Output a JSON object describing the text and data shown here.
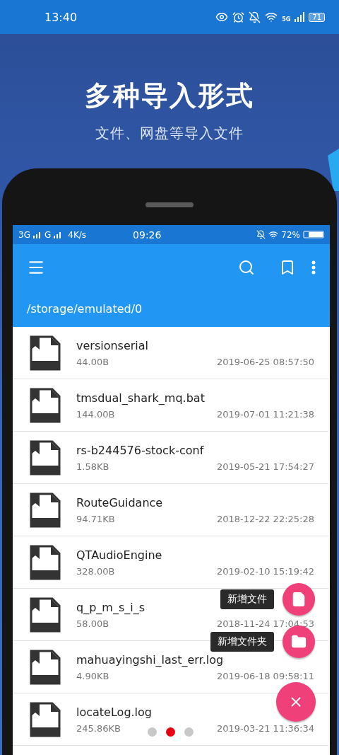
{
  "status_bar": {
    "time": "13:40",
    "network": "5G",
    "battery": "71"
  },
  "headline": "多种导入形式",
  "subheadline": "文件、网盘等导入文件",
  "phone": {
    "status_bar": {
      "network_1": "3G",
      "network_2": "G",
      "speed": "4K/s",
      "time": "09:26",
      "battery": "72%"
    },
    "path": "/storage/emulated/0",
    "files": [
      {
        "name": "versionserial",
        "size": "44.00B",
        "date": "2019-06-25 08:57:50"
      },
      {
        "name": "tmsdual_shark_mq.bat",
        "size": "144.00B",
        "date": "2019-07-01 11:21:38"
      },
      {
        "name": "rs-b244576-stock-conf",
        "size": "1.58KB",
        "date": "2019-05-21 17:54:27"
      },
      {
        "name": "RouteGuidance",
        "size": "94.71KB",
        "date": "2018-12-22 22:25:28"
      },
      {
        "name": "QTAudioEngine",
        "size": "328.00B",
        "date": "2019-02-10 15:19:42"
      },
      {
        "name": "q_p_m_s_i_s",
        "size": "58.00B",
        "date": "2018-11-24 17:04:53"
      },
      {
        "name": "mahuayingshi_last_err.log",
        "size": "4.90KB",
        "date": "2019-06-18 09:58:11"
      },
      {
        "name": "locateLog.log",
        "size": "245.86KB",
        "date": "2019-03-21 11:36:34"
      }
    ],
    "fab_actions": [
      {
        "kind": "file",
        "label": "新增文件"
      },
      {
        "kind": "folder",
        "label": "新增文件夹"
      }
    ]
  },
  "page_dots": [
    {
      "selected": false
    },
    {
      "selected": true
    },
    {
      "selected": false
    }
  ]
}
